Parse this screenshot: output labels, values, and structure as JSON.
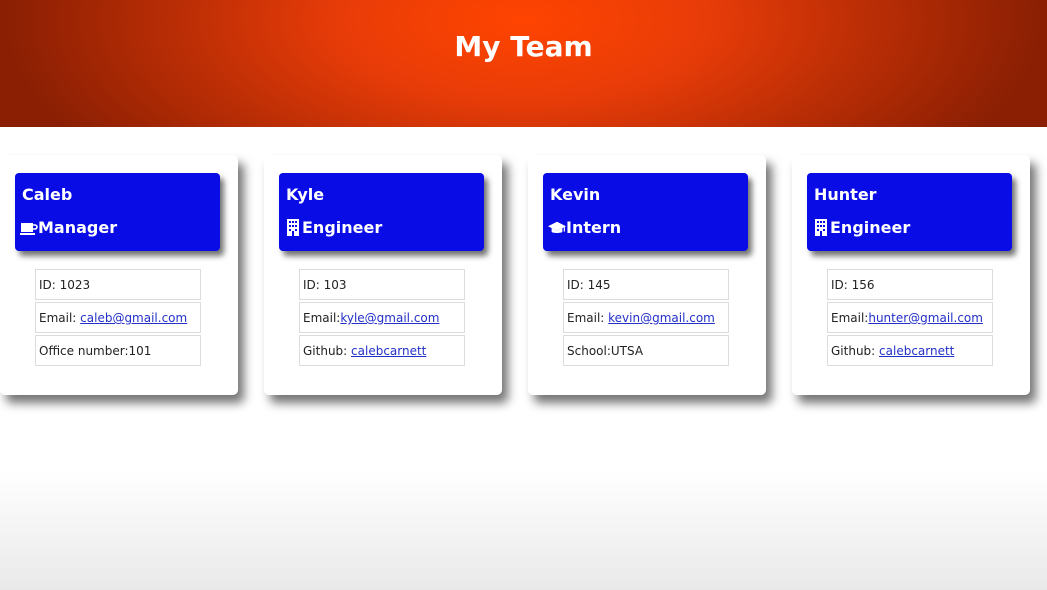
{
  "header": {
    "title": "My Team"
  },
  "team": [
    {
      "name": "Caleb",
      "role": "Manager",
      "role_icon": "mug-icon",
      "id_label": "ID: 1023",
      "email_prefix": "Email: ",
      "email": "caleb@gmail.com",
      "extra_prefix": "Office number:101",
      "extra_link": ""
    },
    {
      "name": "Kyle",
      "role": "Engineer",
      "role_icon": "building-icon",
      "id_label": "ID: 103",
      "email_prefix": "Email:",
      "email": "kyle@gmail.com",
      "extra_prefix": "Github: ",
      "extra_link": "calebcarnett"
    },
    {
      "name": "Kevin",
      "role": "Intern",
      "role_icon": "graduation-cap-icon",
      "id_label": "ID: 145",
      "email_prefix": "Email: ",
      "email": "kevin@gmail.com",
      "extra_prefix": "School:UTSA",
      "extra_link": ""
    },
    {
      "name": "Hunter",
      "role": "Engineer",
      "role_icon": "building-icon",
      "id_label": "ID: 156",
      "email_prefix": "Email:",
      "email": "hunter@gmail.com",
      "extra_prefix": "Github: ",
      "extra_link": "calebcarnett"
    }
  ],
  "colors": {
    "banner": "#ff4400",
    "card_header": "#0a0ce6",
    "link": "#2330c8"
  }
}
